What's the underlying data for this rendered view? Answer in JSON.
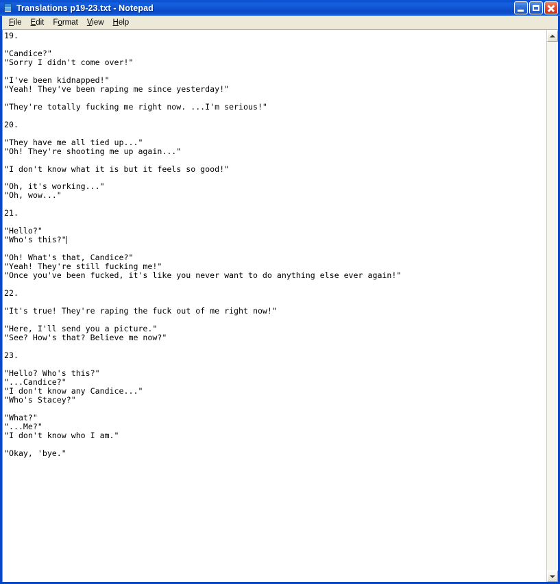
{
  "window": {
    "title": "Translations p19-23.txt - Notepad",
    "icon": "notepad-document-icon",
    "colors": {
      "titlebar_blue": "#0a4ecd",
      "frame_blue": "#0a46c8",
      "client_beige": "#ece9d8",
      "close_red": "#c7301a",
      "text_black": "#000000",
      "page_white": "#ffffff"
    },
    "buttons": {
      "minimize": "Minimize",
      "maximize": "Maximize",
      "close": "Close"
    }
  },
  "menubar": {
    "items": [
      {
        "label": "File",
        "accel": "F"
      },
      {
        "label": "Edit",
        "accel": "E"
      },
      {
        "label": "Format",
        "accel": "o"
      },
      {
        "label": "View",
        "accel": "V"
      },
      {
        "label": "Help",
        "accel": "H"
      }
    ]
  },
  "document": {
    "before_caret": "19.\n\n\"Candice?\"\n\"Sorry I didn't come over!\"\n\n\"I've been kidnapped!\"\n\"Yeah! They've been raping me since yesterday!\"\n\n\"They're totally fucking me right now. ...I'm serious!\"\n\n20.\n\n\"They have me all tied up...\"\n\"Oh! They're shooting me up again...\"\n\n\"I don't know what it is but it feels so good!\"\n\n\"Oh, it's working...\"\n\"Oh, wow...\"\n\n21.\n\n\"Hello?\"\n\"Who's this?\"",
    "after_caret": "\n\n\"Oh! What's that, Candice?\"\n\"Yeah! They're still fucking me!\"\n\"Once you've been fucked, it's like you never want to do anything else ever again!\"\n\n22.\n\n\"It's true! They're raping the fuck out of me right now!\"\n\n\"Here, I'll send you a picture.\"\n\"See? How's that? Believe me now?\"\n\n23.\n\n\"Hello? Who's this?\"\n\"...Candice?\"\n\"I don't know any Candice...\"\n\"Who's Stacey?\"\n\n\"What?\"\n\"...Me?\"\n\"I don't know who I am.\"\n\n\"Okay, 'bye.\"\n"
  },
  "scrollbar": {
    "up_arrow": "scroll-up",
    "down_arrow": "scroll-down"
  }
}
